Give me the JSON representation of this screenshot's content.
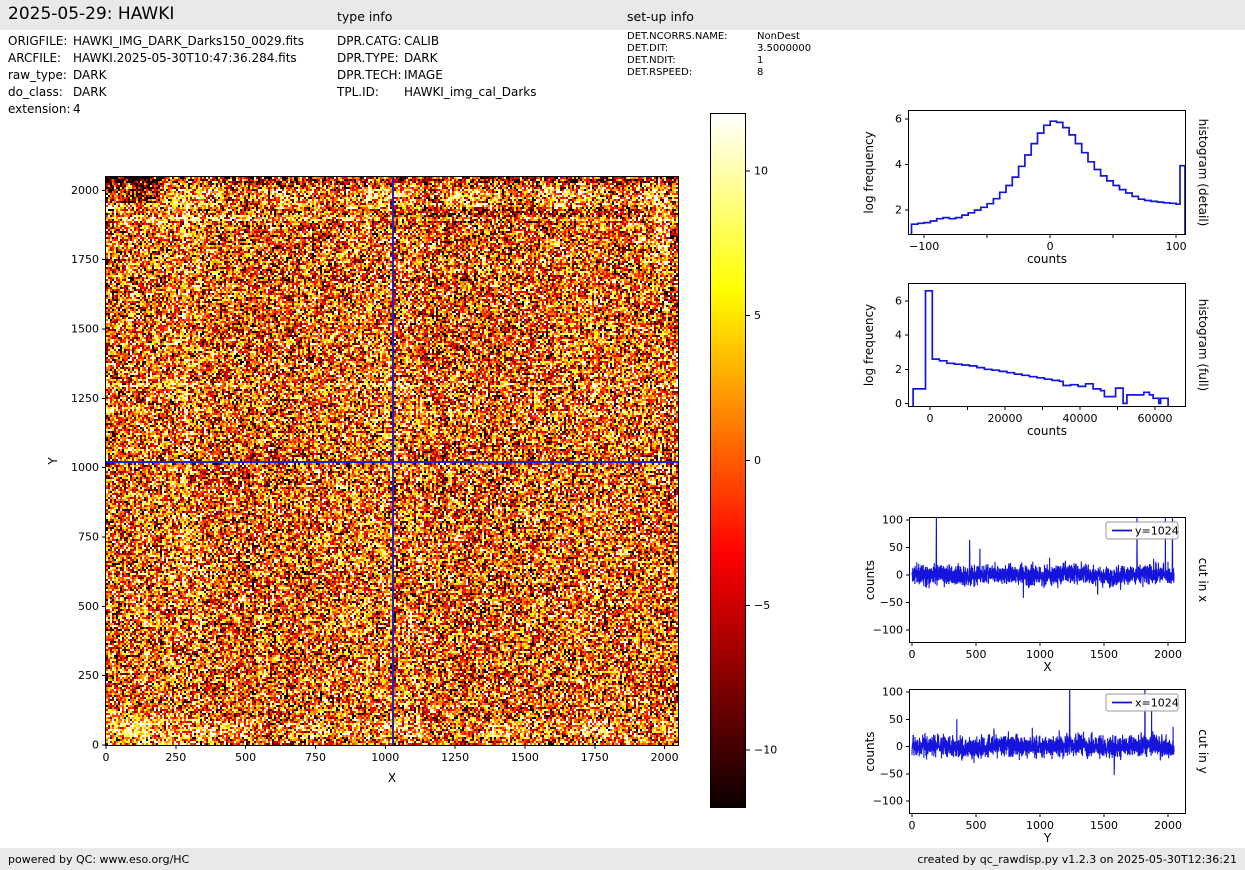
{
  "header": {
    "title": "2025-05-29: HAWKI",
    "type_info_label": "type info",
    "setup_info_label": "set-up info"
  },
  "file_info": {
    "rows": [
      {
        "key": "ORIGFILE:",
        "value": "HAWKI_IMG_DARK_Darks150_0029.fits"
      },
      {
        "key": "ARCFILE:",
        "value": "HAWKI.2025-05-30T10:47:36.284.fits"
      },
      {
        "key": "raw_type:",
        "value": "DARK"
      },
      {
        "key": "do_class:",
        "value": "DARK"
      },
      {
        "key": "extension:",
        "value": "4"
      }
    ]
  },
  "type_info": {
    "rows": [
      {
        "key": "DPR.CATG:",
        "value": "CALIB"
      },
      {
        "key": "DPR.TYPE:",
        "value": "DARK"
      },
      {
        "key": "DPR.TECH:",
        "value": "IMAGE"
      },
      {
        "key": "TPL.ID:",
        "value": "HAWKI_img_cal_Darks"
      }
    ]
  },
  "setup_info": {
    "rows": [
      {
        "key": "DET.NCORRS.NAME:",
        "value": "NonDest"
      },
      {
        "key": "DET.DIT:",
        "value": "3.5000000"
      },
      {
        "key": "DET.NDIT:",
        "value": "1"
      },
      {
        "key": "DET.RSPEED:",
        "value": "8"
      }
    ]
  },
  "footer": {
    "left": "powered by QC: www.eso.org/HC",
    "right": "created by qc_rawdisp.py v1.2.3 on 2025-05-30T12:36:21"
  },
  "colors": {
    "bar_bg": "#e9e9e9",
    "text": "#000000",
    "line_blue": "#1414dc",
    "crosshair_blue": "#2222c8",
    "spine": "#000000",
    "legend_border": "#999999",
    "hot_stops": [
      {
        "pos": 0,
        "color": "#0b0000"
      },
      {
        "pos": 36.5,
        "color": "#ff0000"
      },
      {
        "pos": 74.6,
        "color": "#ffff00"
      },
      {
        "pos": 100,
        "color": "#ffffff"
      }
    ]
  },
  "chart_data": [
    {
      "id": "main_image",
      "type": "heatmap",
      "title": "HAWKI raw dark frame, extension 4",
      "xlabel": "X",
      "ylabel": "Y",
      "xlim": [
        0,
        2048
      ],
      "ylim": [
        0,
        2048
      ],
      "xticks": [
        0,
        250,
        500,
        750,
        1000,
        1250,
        1500,
        1750,
        2000
      ],
      "yticks": [
        0,
        250,
        500,
        750,
        1000,
        1250,
        1500,
        1750,
        2000
      ],
      "colormap": "hot",
      "colorbar": {
        "vmin": -12,
        "vmax": 12,
        "ticks": [
          -10,
          -5,
          0,
          5,
          10
        ]
      },
      "crosshair": {
        "x": 1024,
        "y": 1024
      },
      "noise": {
        "seed": 20250529,
        "sigma": 7.2,
        "salt": 0.004,
        "pepper": 0.004,
        "col_band": 1.3,
        "row_band": 0.8
      },
      "artifacts": [
        {
          "y0": 30,
          "y1": 92,
          "dv": 4.5,
          "wavy": true
        },
        {
          "x1": 300,
          "y1": 115,
          "dv": 2.5
        },
        {
          "y0": 1935,
          "y1": 2008,
          "dv": 4.5,
          "wavy": true,
          "ph": 2.0
        },
        {
          "x1": 190,
          "y0": 1958,
          "dv": -7.5
        },
        {
          "x0": 950,
          "y0": 1885,
          "y1": 1942,
          "dv": -2.8
        },
        {
          "y0": 2030,
          "dv": -4
        },
        {
          "y0": 1893,
          "y1": 1904,
          "dv": 5
        },
        {
          "y0": 1295,
          "y1": 1309,
          "dv": 4.5
        },
        {
          "x0": 1000,
          "y0": 1197,
          "y1": 1207,
          "dv": 3
        },
        {
          "x0": 272,
          "x1": 292,
          "y0": 580,
          "dv": 3.5
        },
        {
          "x0": 543,
          "x1": 561,
          "y1": 1350,
          "dv": 2.5
        },
        {
          "x0": 125,
          "x1": 139,
          "y1": 1050,
          "dv": 2
        },
        {
          "x0": 222,
          "x1": 235,
          "y1": 1050,
          "dv": 2
        },
        {
          "x0": 320,
          "x1": 336,
          "y1": 780,
          "dv": 2
        },
        {
          "x1": 1100,
          "y0": 1118,
          "y1": 1127,
          "dv": 2
        },
        {
          "x0": 1960,
          "x1": 2016,
          "y0": 1700,
          "y1": 1985,
          "dv": 4
        },
        {
          "x0": 2016,
          "x1": 2042,
          "y0": 1450,
          "y1": 1900,
          "dv": -3
        },
        {
          "x1": 12,
          "dv": 2
        },
        {
          "x0": 2036,
          "dv": 2.5
        }
      ]
    },
    {
      "id": "histogram_detail",
      "type": "step",
      "side_label": "histogram (detail)",
      "xlabel": "counts",
      "ylabel": "log frequency",
      "xlim": [
        -112,
        107
      ],
      "ylim": [
        0.95,
        6.35
      ],
      "xticks": [
        -100,
        0,
        100
      ],
      "xminor": [
        -50,
        50
      ],
      "yticks": [
        2,
        4,
        6
      ],
      "edges": [
        -110,
        -105,
        -100,
        -95,
        -90,
        -85,
        -80,
        -75,
        -70,
        -65,
        -60,
        -55,
        -50,
        -45,
        -40,
        -35,
        -30,
        -25,
        -20,
        -15,
        -10,
        -5,
        0,
        5,
        10,
        15,
        20,
        25,
        30,
        35,
        40,
        45,
        50,
        55,
        60,
        65,
        70,
        75,
        80,
        85,
        90,
        95,
        100,
        103,
        107
      ],
      "values": [
        1.38,
        1.42,
        1.45,
        1.52,
        1.62,
        1.67,
        1.62,
        1.67,
        1.78,
        1.88,
        2.0,
        2.12,
        2.28,
        2.5,
        2.78,
        3.08,
        3.45,
        3.92,
        4.42,
        4.92,
        5.38,
        5.72,
        5.9,
        5.85,
        5.62,
        5.3,
        4.92,
        4.52,
        4.12,
        3.78,
        3.5,
        3.28,
        3.08,
        2.9,
        2.75,
        2.6,
        2.48,
        2.42,
        2.38,
        2.35,
        2.32,
        2.3,
        2.26,
        3.95
      ]
    },
    {
      "id": "histogram_full",
      "type": "step",
      "side_label": "histogram (full)",
      "xlabel": "counts",
      "ylabel": "log frequency",
      "xlim": [
        -5600,
        68000
      ],
      "ylim": [
        -0.15,
        7.0
      ],
      "xticks": [
        0,
        20000,
        40000,
        60000
      ],
      "xminor": [
        10000,
        30000,
        50000
      ],
      "yticks": [
        0,
        2,
        4,
        6
      ],
      "edges": [
        -4500,
        -1200,
        600,
        2500,
        4500,
        6500,
        8500,
        10500,
        12500,
        14500,
        16500,
        18500,
        20500,
        22500,
        24500,
        26500,
        28500,
        30500,
        32500,
        34500,
        35500,
        37500,
        39500,
        41500,
        43500,
        45500,
        46500,
        49500,
        51500,
        52500,
        57000,
        58500,
        59500,
        61000,
        61500,
        63500
      ],
      "values": [
        0.85,
        6.6,
        2.6,
        2.5,
        2.35,
        2.3,
        2.25,
        2.2,
        2.1,
        2.0,
        1.95,
        1.88,
        1.8,
        1.72,
        1.65,
        1.57,
        1.5,
        1.42,
        1.35,
        1.3,
        1.05,
        1.1,
        1.0,
        1.15,
        0.85,
        0.75,
        0.4,
        0.9,
        0.0,
        0.5,
        0.65,
        0.5,
        0.3,
        0.0,
        0.3
      ]
    },
    {
      "id": "cut_in_x",
      "type": "cut",
      "side_label": "cut in x",
      "xlabel": "X",
      "ylabel": "counts",
      "legend_label": "y=1024",
      "xlim": [
        -16,
        2133
      ],
      "ylim": [
        -122,
        104
      ],
      "xticks": [
        0,
        500,
        1000,
        1500,
        2000
      ],
      "yticks": [
        -100,
        -50,
        0,
        50,
        100
      ],
      "n": 2048,
      "noise": {
        "seed": 11,
        "sigma": 9
      },
      "spikes": [
        {
          "x": 190,
          "v": 118
        },
        {
          "x": 450,
          "v": 80
        },
        {
          "x": 530,
          "v": 46
        },
        {
          "x": 1075,
          "v": 30
        },
        {
          "x": 1758,
          "v": 150
        },
        {
          "x": 1980,
          "v": 130
        },
        {
          "x": 2035,
          "v": 125
        },
        {
          "x": 870,
          "v": -37
        },
        {
          "x": 1450,
          "v": -38
        }
      ]
    },
    {
      "id": "cut_in_y",
      "type": "cut",
      "side_label": "cut in y",
      "xlabel": "Y",
      "ylabel": "counts",
      "legend_label": "x=1024",
      "xlim": [
        -16,
        2133
      ],
      "ylim": [
        -122,
        104
      ],
      "xticks": [
        0,
        500,
        1000,
        1500,
        2000
      ],
      "yticks": [
        -100,
        -50,
        0,
        50,
        100
      ],
      "n": 2048,
      "noise": {
        "seed": 23,
        "sigma": 9.5
      },
      "spikes": [
        {
          "x": 350,
          "v": 52
        },
        {
          "x": 640,
          "v": 36
        },
        {
          "x": 940,
          "v": 40
        },
        {
          "x": 1150,
          "v": 46
        },
        {
          "x": 1232,
          "v": 170
        },
        {
          "x": 1820,
          "v": 150
        },
        {
          "x": 1872,
          "v": 48
        },
        {
          "x": 2040,
          "v": 38
        },
        {
          "x": 1580,
          "v": -56
        }
      ]
    }
  ]
}
